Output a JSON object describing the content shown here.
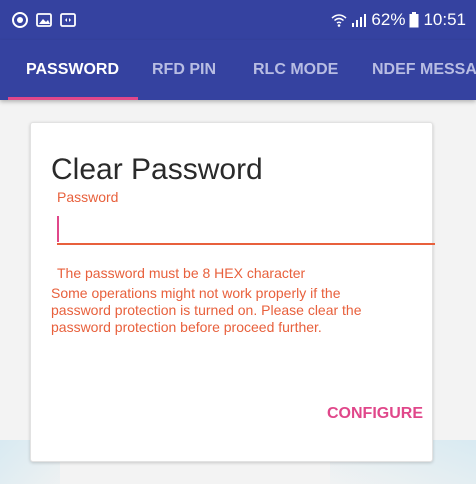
{
  "status_bar": {
    "icons_left": [
      "app-notification-icon",
      "image-icon",
      "screen-mirror-icon"
    ],
    "battery": "62%",
    "time": "10:51"
  },
  "tabs": [
    {
      "label": "PASSWORD",
      "active": true
    },
    {
      "label": "RFD PIN",
      "active": false
    },
    {
      "label": "RLC MODE",
      "active": false
    },
    {
      "label": "NDEF MESSA",
      "active": false
    }
  ],
  "card": {
    "title": "Clear Password",
    "field_label": "Password",
    "field_value": "",
    "hint": "The password must be 8 HEX character",
    "warning": "Some operations might not work properly if the password protection is turned on. Please clear the password protection before proceed further.",
    "button_label": "CONFIGURE"
  },
  "colors": {
    "primary": "#3542a0",
    "accent": "#e0478a",
    "error": "#e8603c"
  }
}
